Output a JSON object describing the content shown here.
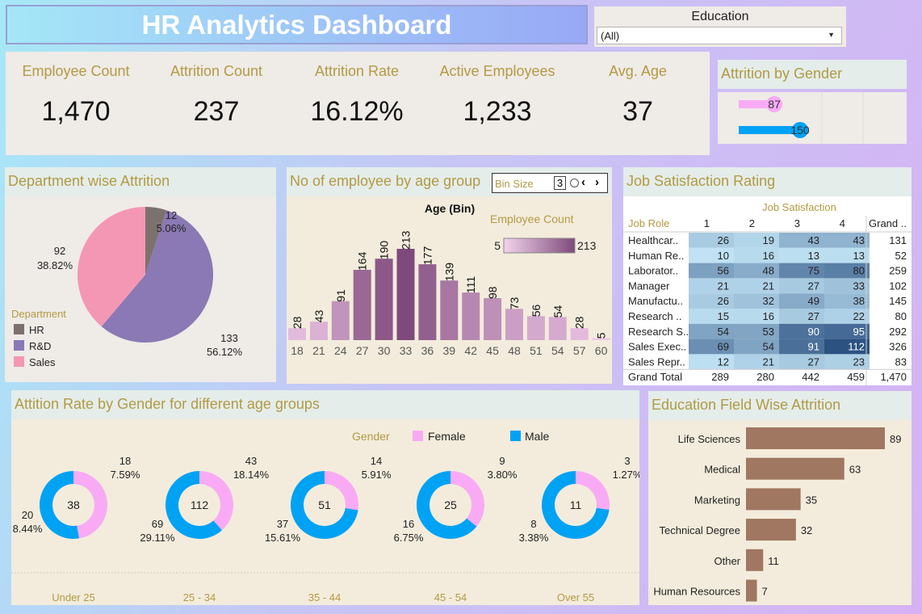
{
  "header": {
    "title": "HR Analytics Dashboard"
  },
  "filter": {
    "label": "Education",
    "value": "(All)"
  },
  "kpis": [
    {
      "label": "Employee Count",
      "value": "1,470"
    },
    {
      "label": "Attrition Count",
      "value": "237"
    },
    {
      "label": "Attrition Rate",
      "value": "16.12%"
    },
    {
      "label": "Active Employees",
      "value": "1,233"
    },
    {
      "label": "Avg. Age",
      "value": "37"
    }
  ],
  "colors": {
    "female": "#f9aaf5",
    "male": "#00a2f3",
    "hr": "#7d716e",
    "rd": "#8a79b4",
    "sales": "#f497b4",
    "bar_edu": "#a07760"
  },
  "gender_panel": {
    "title": "Attrition by Gender"
  },
  "dept_panel": {
    "title": "Department wise Attrition",
    "legend_title": "Department"
  },
  "age_panel": {
    "title": "No of employee by age group",
    "bin_label": "Bin Size",
    "bin_value": "3",
    "axis_title": "Age (Bin)",
    "legend_title": "Employee Count",
    "legend_min": "5",
    "legend_max": "213"
  },
  "job_panel": {
    "title": "Job Satisfaction Rating",
    "col_title": "Job Satisfaction",
    "row_header": "Job Role",
    "total_header": "Grand ..",
    "total_row_label": "Grand Total"
  },
  "gender_age_panel": {
    "title": "Attition Rate by Gender for different age groups",
    "legend_title": "Gender"
  },
  "edu_panel": {
    "title": "Education Field Wise Attrition"
  },
  "chart_data": [
    {
      "type": "bar",
      "title": "Attrition by Gender",
      "categories": [
        "Female",
        "Male"
      ],
      "values": [
        87,
        150
      ]
    },
    {
      "type": "pie",
      "title": "Department wise Attrition",
      "categories": [
        "HR",
        "R&D",
        "Sales"
      ],
      "values": [
        12,
        133,
        92
      ],
      "labels": [
        "5.06%",
        "56.12%",
        "38.82%"
      ]
    },
    {
      "type": "bar",
      "title": "No of employee by age group",
      "xlabel": "Age (Bin)",
      "categories": [
        "18",
        "21",
        "24",
        "27",
        "30",
        "33",
        "36",
        "39",
        "42",
        "45",
        "48",
        "51",
        "54",
        "57",
        "60"
      ],
      "values": [
        28,
        43,
        91,
        164,
        190,
        213,
        177,
        139,
        111,
        98,
        73,
        56,
        54,
        28,
        5
      ]
    },
    {
      "type": "table",
      "title": "Job Satisfaction Rating",
      "columns": [
        "1",
        "2",
        "3",
        "4"
      ],
      "rows": [
        {
          "label": "Healthcar..",
          "values": [
            26,
            19,
            43,
            43
          ],
          "total": "131"
        },
        {
          "label": "Human Re..",
          "values": [
            10,
            16,
            13,
            13
          ],
          "total": "52"
        },
        {
          "label": "Laborator..",
          "values": [
            56,
            48,
            75,
            80
          ],
          "total": "259"
        },
        {
          "label": "Manager",
          "values": [
            21,
            21,
            27,
            33
          ],
          "total": "102"
        },
        {
          "label": "Manufactu..",
          "values": [
            26,
            32,
            49,
            38
          ],
          "total": "145"
        },
        {
          "label": "Research ..",
          "values": [
            15,
            16,
            27,
            22
          ],
          "total": "80"
        },
        {
          "label": "Research S..",
          "values": [
            54,
            53,
            90,
            95
          ],
          "total": "292"
        },
        {
          "label": "Sales Exec..",
          "values": [
            69,
            54,
            91,
            112
          ],
          "total": "326"
        },
        {
          "label": "Sales Repr..",
          "values": [
            12,
            21,
            27,
            23
          ],
          "total": "83"
        }
      ],
      "grand_total": {
        "values": [
          "289",
          "280",
          "442",
          "459"
        ],
        "total": "1,470"
      }
    },
    {
      "type": "pie",
      "title": "Attition Rate by Gender for different age groups",
      "series_names": [
        "Female",
        "Male"
      ],
      "groups": [
        {
          "label": "Under 25",
          "total": "38",
          "female": 18,
          "female_pct": "7.59%",
          "male": 20,
          "male_pct": "8.44%"
        },
        {
          "label": "25 - 34",
          "total": "112",
          "female": 43,
          "female_pct": "18.14%",
          "male": 69,
          "male_pct": "29.11%"
        },
        {
          "label": "35 - 44",
          "total": "51",
          "female": 14,
          "female_pct": "5.91%",
          "male": 37,
          "male_pct": "15.61%"
        },
        {
          "label": "45 - 54",
          "total": "25",
          "female": 9,
          "female_pct": "3.80%",
          "male": 16,
          "male_pct": "6.75%"
        },
        {
          "label": "Over 55",
          "total": "11",
          "female": 3,
          "female_pct": "1.27%",
          "male": 8,
          "male_pct": "3.38%"
        }
      ]
    },
    {
      "type": "bar",
      "title": "Education Field Wise Attrition",
      "categories": [
        "Life Sciences",
        "Medical",
        "Marketing",
        "Technical Degree",
        "Other",
        "Human Resources"
      ],
      "values": [
        89,
        63,
        35,
        32,
        11,
        7
      ]
    }
  ]
}
